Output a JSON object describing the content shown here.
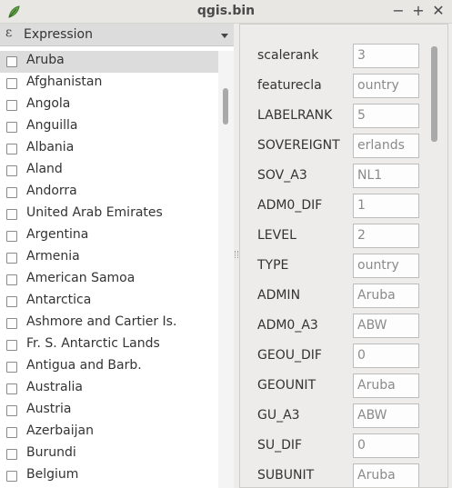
{
  "window": {
    "title": "qgis.bin",
    "minimize_symbol": "−",
    "maximize_symbol": "+",
    "close_symbol": "✕",
    "app_icon": "qgis-leaf-icon"
  },
  "expression_bar": {
    "icon_symbol": "ε",
    "label": "Expression",
    "dropdown_icon": "chevron-down-icon"
  },
  "features": [
    {
      "label": "Aruba",
      "selected": true
    },
    {
      "label": "Afghanistan"
    },
    {
      "label": "Angola"
    },
    {
      "label": "Anguilla"
    },
    {
      "label": "Albania"
    },
    {
      "label": "Aland"
    },
    {
      "label": "Andorra"
    },
    {
      "label": "United Arab Emirates"
    },
    {
      "label": "Argentina"
    },
    {
      "label": "Armenia"
    },
    {
      "label": "American Samoa"
    },
    {
      "label": "Antarctica"
    },
    {
      "label": "Ashmore and Cartier Is."
    },
    {
      "label": "Fr. S. Antarctic Lands"
    },
    {
      "label": "Antigua and Barb."
    },
    {
      "label": "Australia"
    },
    {
      "label": "Austria"
    },
    {
      "label": "Azerbaijan"
    },
    {
      "label": "Burundi"
    },
    {
      "label": "Belgium"
    }
  ],
  "attributes": [
    {
      "name": "scalerank",
      "value": "3"
    },
    {
      "name": "featurecla",
      "value": "ountry"
    },
    {
      "name": "LABELRANK",
      "value": "5"
    },
    {
      "name": "SOVEREIGNT",
      "value": "erlands"
    },
    {
      "name": "SOV_A3",
      "value": "NL1"
    },
    {
      "name": "ADM0_DIF",
      "value": "1"
    },
    {
      "name": "LEVEL",
      "value": "2"
    },
    {
      "name": "TYPE",
      "value": "ountry"
    },
    {
      "name": "ADMIN",
      "value": "Aruba"
    },
    {
      "name": "ADM0_A3",
      "value": "ABW"
    },
    {
      "name": "GEOU_DIF",
      "value": "0"
    },
    {
      "name": "GEOUNIT",
      "value": "Aruba"
    },
    {
      "name": "GU_A3",
      "value": "ABW"
    },
    {
      "name": "SU_DIF",
      "value": "0"
    },
    {
      "name": "SUBUNIT",
      "value": "Aruba"
    }
  ],
  "colors": {
    "selection": "#dcdcdc",
    "window_bg": "#edecea",
    "input_text": "#8a8a8a"
  }
}
